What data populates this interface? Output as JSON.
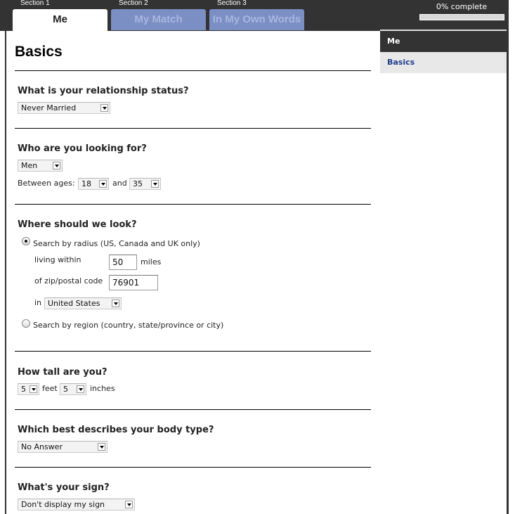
{
  "header": {
    "sections": [
      {
        "section_label": "Section 1",
        "tab_label": "Me",
        "active": true
      },
      {
        "section_label": "Section 2",
        "tab_label": "My Match",
        "active": false
      },
      {
        "section_label": "Section 3",
        "tab_label": "In My Own Words",
        "active": false
      }
    ],
    "progress": {
      "text": "0% complete",
      "percent": 0
    }
  },
  "sidebar": {
    "header": "Me",
    "items": [
      {
        "label": "Basics",
        "selected": true
      }
    ]
  },
  "main": {
    "title": "Basics",
    "relationship": {
      "question": "What is your relationship status?",
      "value": "Never Married"
    },
    "looking_for": {
      "question": "Who are you looking for?",
      "gender_value": "Men",
      "ages_label": "Between ages:",
      "min_age": "18",
      "and_label": "and",
      "max_age": "35"
    },
    "where": {
      "question": "Where should we look?",
      "radius_option": {
        "label": "Search by radius (US, Canada and UK only)",
        "selected": true
      },
      "living_within_label": "living within",
      "distance_value": "50",
      "miles_label": "miles",
      "zip_label": "of zip/postal code",
      "zip_value": "76901",
      "in_label": "in",
      "country_value": "United States",
      "region_option": {
        "label": "Search by region (country, state/province or city)",
        "selected": false
      }
    },
    "height": {
      "question": "How tall are you?",
      "feet_value": "5",
      "feet_label": "feet",
      "inches_value": "5",
      "inches_label": "inches"
    },
    "body_type": {
      "question": "Which best describes your body type?",
      "value": "No Answer"
    },
    "sign": {
      "question": "What's your sign?",
      "value": "Don't display my sign"
    }
  },
  "colors": {
    "dark_bar": "#333333",
    "inactive_tab": "#7b8fc4",
    "inactive_tab_text": "#a8b6df",
    "sidebar_link": "#1f3d8a",
    "sidebar_selected_bg": "#e8e8e8"
  }
}
